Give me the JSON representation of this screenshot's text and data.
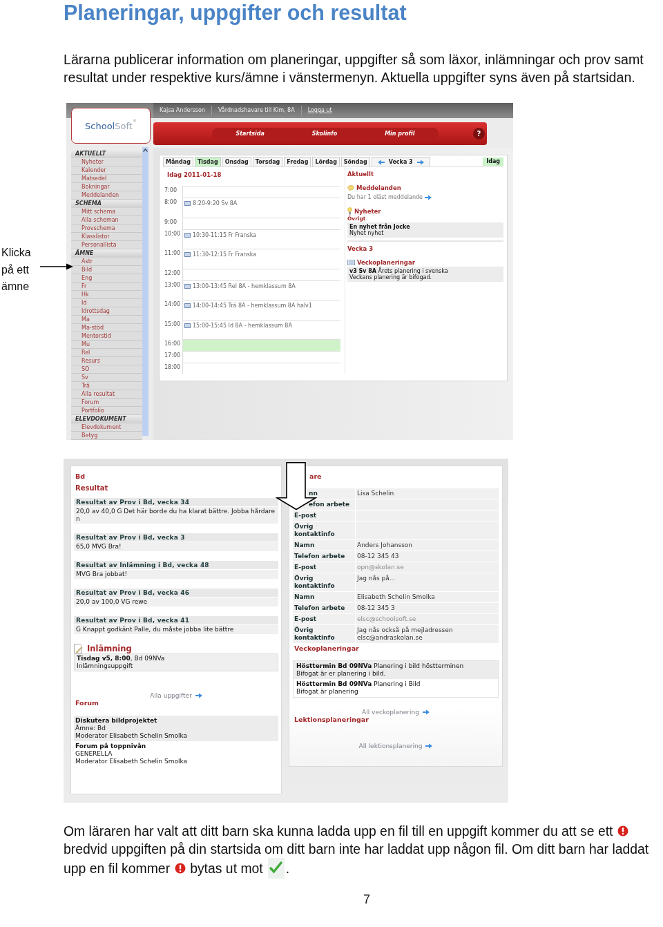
{
  "title": "Planeringar, uppgifter och resultat",
  "intro": "Lärarna publicerar information om planeringar, uppgifter så som läxor, inlämningar och prov samt resultat under respektive kurs/ämne i vänstermenyn. Aktuella uppgifter syns även på startsidan.",
  "figure_1": {
    "annotation": "Klicka på ett ämne",
    "screenshot": {
      "logo": {
        "part_1": "School",
        "part_2": "Soft",
        "mark": "®"
      },
      "user_bar": [
        "Kajsa Andersson",
        "Vårdnadshavare till Kim, 8A",
        "Logga ut"
      ],
      "nav": [
        "Startsida",
        "Skolinfo",
        "Min profil"
      ],
      "help": "?",
      "sidebar": [
        {
          "title": "AKTUELLT",
          "items": [
            "Nyheter",
            "Kalender",
            "Matsedel",
            "Bokningar",
            "Meddelanden"
          ]
        },
        {
          "title": "SCHEMA",
          "items": [
            "Mitt schema",
            "Alla scheman",
            "Provschema",
            "Klasslistor",
            "Personallista"
          ]
        },
        {
          "title": "ÄMNE",
          "items": [
            "Astr",
            "Bild",
            "Eng",
            "Fr",
            "Hk",
            "Id",
            "Idrottsdag",
            "Ma",
            "Ma-stöd",
            "Mentorstid",
            "Mu",
            "Rel",
            "Resurs",
            "SO",
            "Sv",
            "Trä",
            "Alla resultat",
            "Forum",
            "Portfolio"
          ]
        },
        {
          "title": "ELEVDOKUMENT",
          "items": [
            "Elevdokument",
            "Betyg"
          ]
        }
      ],
      "day_tabs": [
        {
          "label": "Måndag",
          "selected": false
        },
        {
          "label": "Tisdag",
          "selected": true
        },
        {
          "label": "Onsdag",
          "selected": false
        },
        {
          "label": "Torsdag",
          "selected": false
        },
        {
          "label": "Fredag",
          "selected": false
        },
        {
          "label": "Lördag",
          "selected": false
        },
        {
          "label": "Söndag",
          "selected": false
        }
      ],
      "week_tab": "Vecka 3",
      "today_button": "Idag",
      "schedule": {
        "heading": "Idag 2011-01-18",
        "rows": [
          {
            "time": "7:00",
            "current": false
          },
          {
            "time": "8:00",
            "event": "8:20-9:20 Sv 8A",
            "current": false
          },
          {
            "time": "9:00",
            "current": false
          },
          {
            "time": "10:00",
            "event": "10:30-11:15 Fr Franska",
            "current": false
          },
          {
            "time": "11:00",
            "event": "11:30-12:15 Fr Franska",
            "current": false
          },
          {
            "time": "12:00",
            "current": false
          },
          {
            "time": "13:00",
            "event": "13:00-13:45 Rel 8A - hemklassum 8A",
            "current": false
          },
          {
            "time": "14:00",
            "event": "14:00-14:45 Trä 8A - hemklassum 8A halv1",
            "current": false
          },
          {
            "time": "15:00",
            "event": "15:00-15:45 Id 8A - hemklassum 8A",
            "current": false
          },
          {
            "time": "16:00",
            "current": true
          },
          {
            "time": "17:00",
            "current": false
          },
          {
            "time": "18:00",
            "current": false
          }
        ]
      },
      "news_panel": {
        "heading": "Aktuellt",
        "messages": {
          "heading": "Meddelanden",
          "link": "Du har 1 oläst meddelande"
        },
        "news": {
          "heading": "Nyheter",
          "category": "Övrigt",
          "item": {
            "title": "En nyhet från Jocke",
            "text": "Nyhet nyhet"
          }
        },
        "week_heading": "Vecka 3",
        "week_plans": {
          "heading": "Veckoplaneringar",
          "item": {
            "line_1": "**v3 Sv 8A** Årets planering i svenska",
            "line_2": "Veckans planering är bifogad."
          }
        }
      }
    }
  },
  "figure_2": {
    "left": {
      "course": "Bd",
      "results_heading": "Resultat",
      "results": [
        {
          "title": "Resultat av Prov i Bd, vecka 34",
          "text": "20,0 av 40,0 G Det här borde du ha klarat bättre. Jobba hårdare n"
        },
        {
          "title": "Resultat av Prov i Bd, vecka 3",
          "text": "65,0 MVG Bra!"
        },
        {
          "title": "Resultat av Inlämning i Bd, vecka 48",
          "text": "MVG Bra jobbat!"
        },
        {
          "title": "Resultat av Prov i Bd, vecka 46",
          "text": "20,0 av 100,0 VG rewe"
        },
        {
          "title": "Resultat av Prov i Bd, vecka 41",
          "text": "G Knappt godkänt Palle, du måste jobba lite bättre"
        }
      ],
      "submissions_heading": "Inlämning",
      "submissions": [
        {
          "line_1": "**Tisdag v5, 8:00**, Bd 09NVa",
          "line_2": "Inlämningsuppgift"
        }
      ],
      "all_link": "Alla uppgifter",
      "forum_heading": "Forum",
      "forum": [
        {
          "title": "Diskutera bildprojektet",
          "lines": [
            "Ämne: Bd",
            "Moderator Elisabeth Schelin Smolka"
          ]
        },
        {
          "title": "Forum på toppnivån",
          "lines": [
            "GENERELLA",
            "Moderator Elisabeth Schelin Smolka"
          ]
        }
      ]
    },
    "right": {
      "heading": {
        "text": "are",
        "covered": true
      },
      "contacts": [
        {
          "label": "nn",
          "covered": true,
          "value": "Lisa Schelin",
          "kind": "text"
        },
        {
          "label": "efon arbete",
          "covered": true
        },
        {
          "label": "E-post",
          "covered": false
        },
        {
          "label": "Övrig kontaktinfo",
          "covered": false
        },
        {
          "label": "Namn",
          "covered": false,
          "value": "Anders Johansson",
          "kind": "text"
        },
        {
          "label": "Telefon arbete",
          "covered": false,
          "value": "08-12 345 43",
          "kind": "text"
        },
        {
          "label": "E-post",
          "covered": false,
          "value": "opn@skolan.se",
          "kind": "link"
        },
        {
          "label": "Övrig kontaktinfo",
          "covered": false,
          "value": "Jag nås på...",
          "kind": "text"
        },
        {
          "label": "Namn",
          "covered": false,
          "value": "Elisabeth Schelin Smolka",
          "kind": "text"
        },
        {
          "label": "Telefon arbete",
          "covered": false,
          "value": "08-12 345 3",
          "kind": "text"
        },
        {
          "label": "E-post",
          "covered": false,
          "value": "elsc@schoolsoft.se",
          "kind": "link"
        },
        {
          "label": "Övrig kontaktinfo",
          "covered": false,
          "value": "Jag nås också på mejladressen elsc@andraskolan.se",
          "kind": "text"
        }
      ],
      "week_plans_heading": "Veckoplaneringar",
      "week_plans": [
        {
          "line_1": "**Hösttermin Bd 09NVa** Planering i bild höstterminen",
          "line_2": "Bifogat är er planering i bild."
        },
        {
          "line_1": "**Hösttermin Bd 09NVa** Planering i Bild",
          "line_2": "Bifogat är planering"
        }
      ],
      "week_plans_link": "All veckoplanering",
      "lesson_plans_heading": "Lektionsplaneringar",
      "lesson_plans_link": "All lektionsplanering"
    }
  },
  "footer": [
    {
      "kind": "text",
      "text": "Om läraren har valt att ditt barn ska kunna ladda upp en fil till en uppgift kommer du att se ett"
    },
    {
      "kind": "alert"
    },
    {
      "kind": "text",
      "text": "bredvid uppgiften på din startsida om ditt barn inte har laddat upp någon fil. Om ditt barn har laddat"
    },
    {
      "kind": "text",
      "text": "upp en fil kommer"
    },
    {
      "kind": "alert"
    },
    {
      "kind": "text",
      "text": "bytas ut mot"
    },
    {
      "kind": "check"
    },
    {
      "kind": "text",
      "text": "."
    }
  ],
  "page_number": "7"
}
